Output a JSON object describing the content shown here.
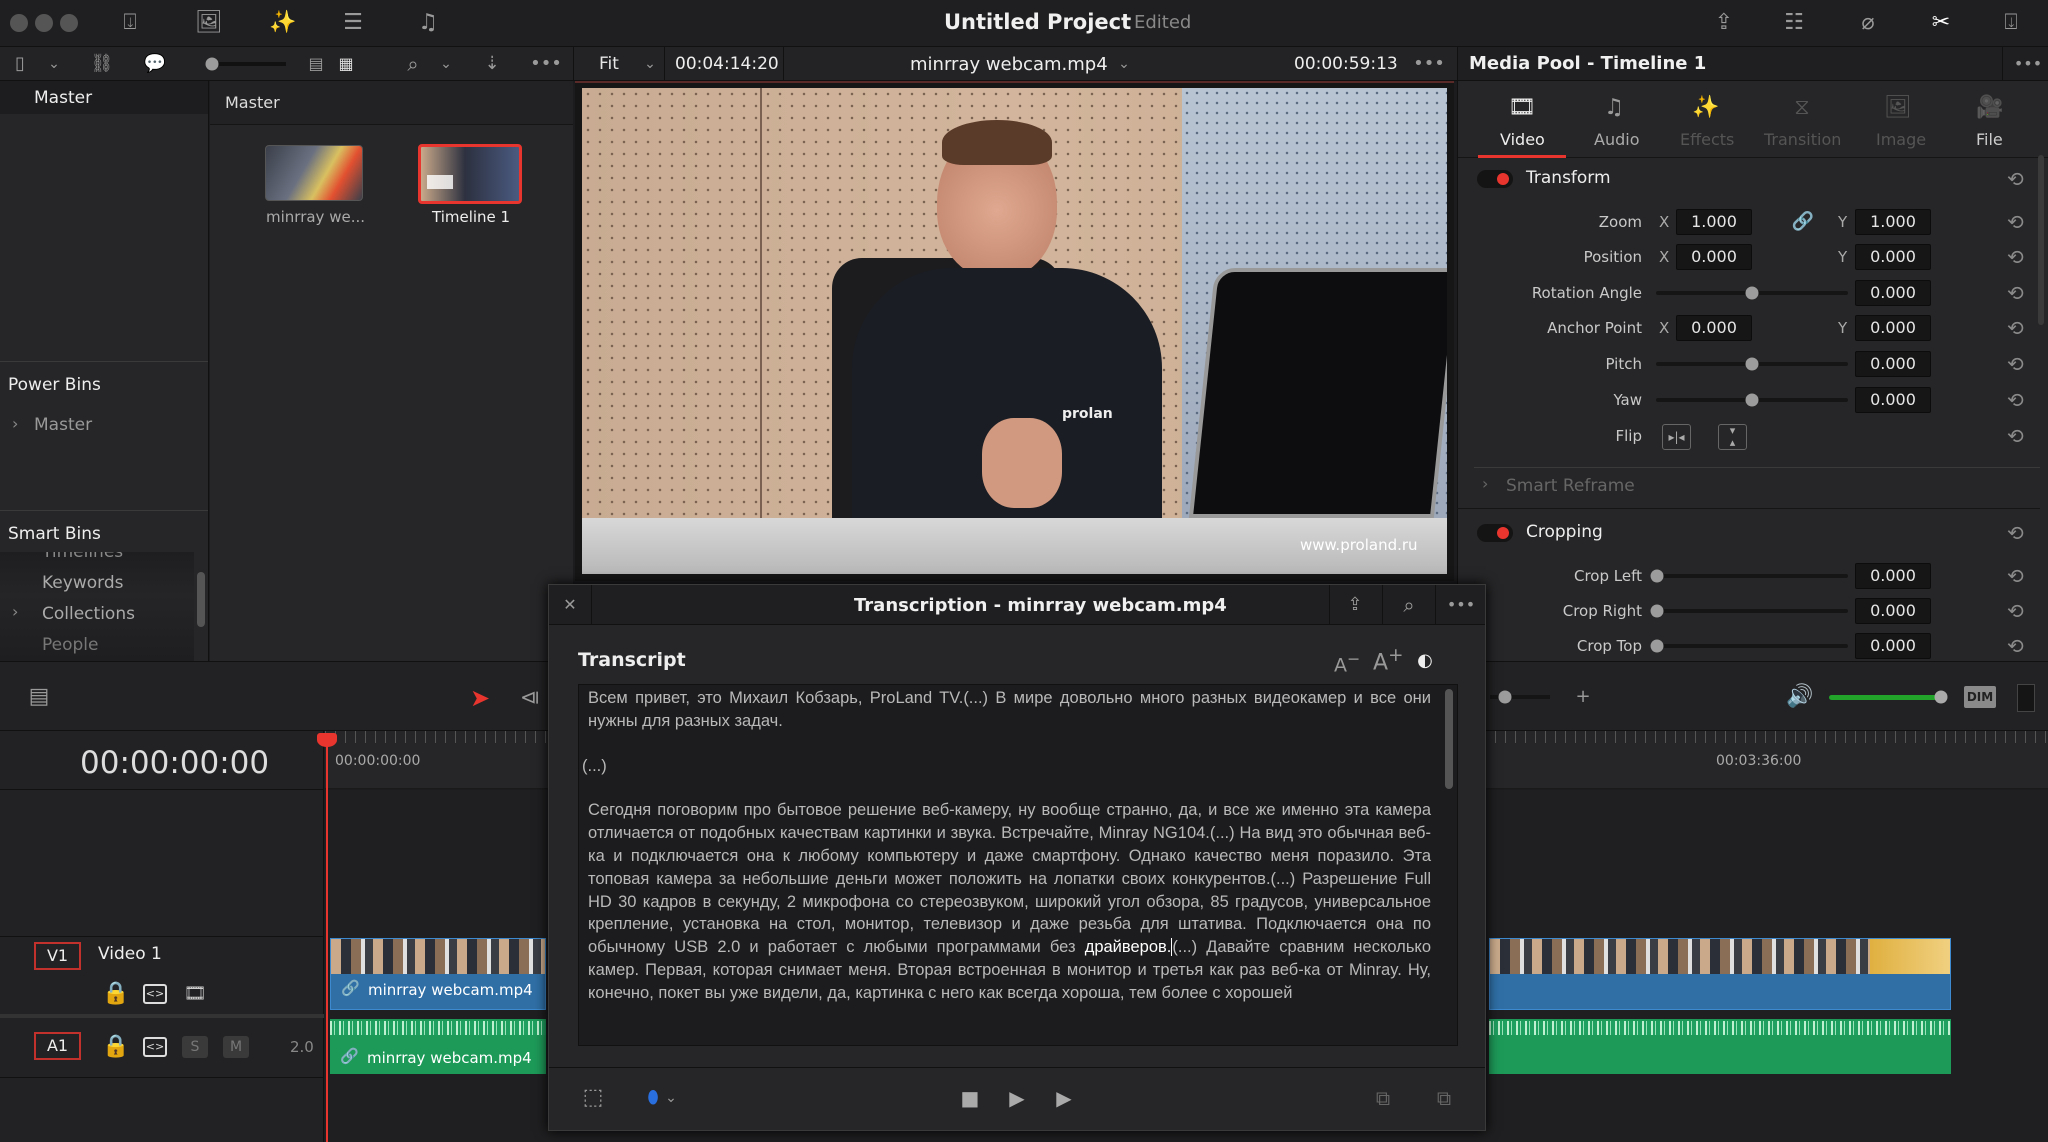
{
  "app": {
    "title": "Untitled Project",
    "status": "Edited"
  },
  "viewer": {
    "zoom": "Fit",
    "source_timecode": "00:04:14:20",
    "clip_name": "minrray webcam.mp4",
    "timecode": "00:00:59:13",
    "watermark": "www.proland.ru",
    "logo_text": "prolan"
  },
  "left_panel": {
    "master": "Master",
    "power_bins": "Power Bins",
    "power_bin_items": [
      "Master"
    ],
    "smart_bins": "Smart Bins",
    "smart_bin_items": [
      "Timelines",
      "Keywords",
      "Collections",
      "People"
    ]
  },
  "bin": {
    "header": "Master",
    "items": [
      {
        "label": "minrray we..."
      },
      {
        "label": "Timeline 1"
      }
    ]
  },
  "inspector": {
    "title": "Media Pool - Timeline 1",
    "tabs": [
      {
        "label": "Video",
        "active": true
      },
      {
        "label": "Audio"
      },
      {
        "label": "Effects"
      },
      {
        "label": "Transition"
      },
      {
        "label": "Image"
      },
      {
        "label": "File"
      }
    ],
    "transform": {
      "title": "Transform",
      "zoom_label": "Zoom",
      "zoom_x": "1.000",
      "zoom_y": "1.000",
      "position_label": "Position",
      "position_x": "0.000",
      "position_y": "0.000",
      "rotation_label": "Rotation Angle",
      "rotation": "0.000",
      "anchor_label": "Anchor Point",
      "anchor_x": "0.000",
      "anchor_y": "0.000",
      "pitch_label": "Pitch",
      "pitch": "0.000",
      "yaw_label": "Yaw",
      "yaw": "0.000",
      "flip_label": "Flip",
      "x": "X",
      "y": "Y"
    },
    "smart_reframe": "Smart Reframe",
    "cropping": {
      "title": "Cropping",
      "rows": [
        {
          "label": "Crop Left",
          "value": "0.000"
        },
        {
          "label": "Crop Right",
          "value": "0.000"
        },
        {
          "label": "Crop Top",
          "value": "0.000"
        }
      ]
    }
  },
  "timeline": {
    "timecode": "00:00:00:00",
    "ruler": [
      "00:00:00:00",
      "00:03:36:00"
    ],
    "dim": "DIM",
    "volume_percent": 100,
    "v1": {
      "id": "V1",
      "name": "Video 1",
      "clip": "minrray webcam.mp4"
    },
    "a1": {
      "id": "A1",
      "solo": "S",
      "mute": "M",
      "channels": "2.0",
      "clip": "minrray webcam.mp4"
    }
  },
  "transcription": {
    "title": "Transcription - minrray webcam.mp4",
    "section": "Transcript",
    "font_smaller": "A",
    "font_larger": "A",
    "p1": "Всем привет, это Михаил Кобзарь, ProLand TV.(...) В мире довольно много разных видеокамер и все они нужны для разных задач.",
    "p2": "(...)",
    "p3_before": "Сегодня поговорим про бытовое решение веб-камеру, ну вообще странно, да, и все же именно эта камера отличается от подобных качествам картинки и звука. Встречайте, Minray NG104.(...) На вид это обычная веб-ка и подключается она к любому компьютеру и даже смартфону. Однако качество меня поразило. Эта топовая камера за небольшие деньги может положить на лопатки своих конкурентов.(...) Разрешение Full HD 30 кадров в секунду, 2 микрофона со стереозвуком, широкий угол обзора, 85 градусов, универсальное крепление, установка на стол, монитор, телевизор и даже резьба для штатива. Подключается она по обычному USB 2.0 и работает с любыми программами без ",
    "p3_highlight": "драйверов.",
    "p3_after": "(...) Давайте сравним несколько камер. Первая, которая снимает меня. Вторая встроенная в монитор и третья как раз веб-ка от Minray. Ну, конечно, покет вы уже видели, да, картинка с него как всегда хороша, тем более с хорошей"
  },
  "colors": {
    "accent": "#e8352e",
    "video_clip": "#2f6fa6",
    "audio_clip": "#1d9a58",
    "volume": "#22a32a"
  }
}
